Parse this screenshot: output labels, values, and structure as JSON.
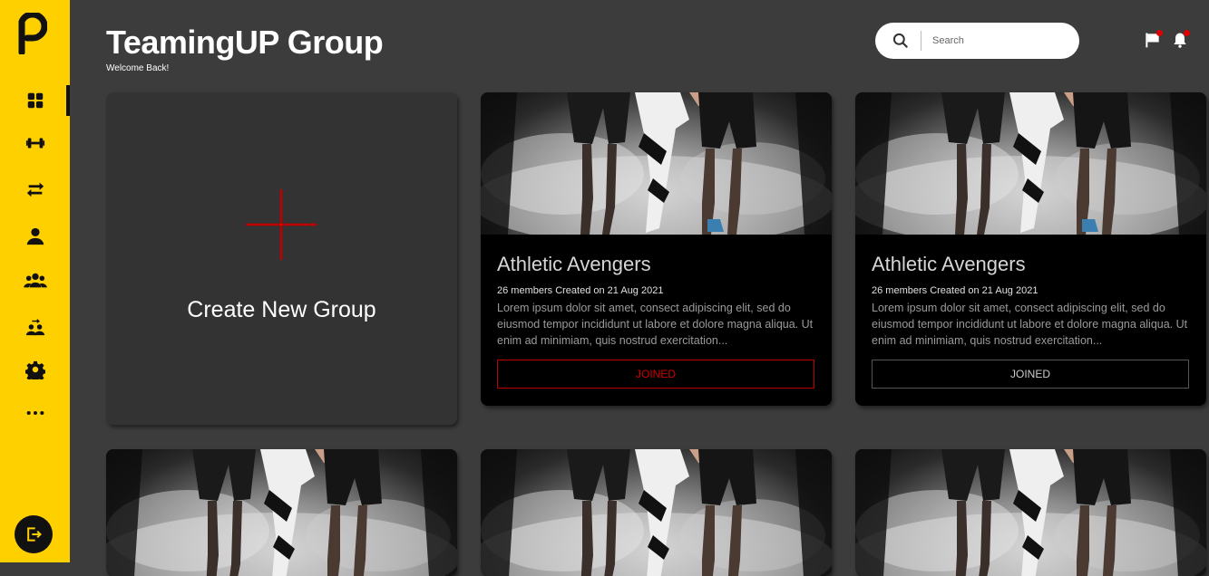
{
  "header": {
    "title": "TeamingUP Group",
    "subtitle": "Welcome Back!"
  },
  "search": {
    "placeholder": "Search"
  },
  "sidebar": {
    "items": [
      {
        "icon": "dashboard-icon"
      },
      {
        "icon": "dumbbell-icon"
      },
      {
        "icon": "transfer-arrows-icon"
      },
      {
        "icon": "user-icon"
      },
      {
        "icon": "group-icon"
      },
      {
        "icon": "team-connect-icon"
      },
      {
        "icon": "gear-icon"
      },
      {
        "icon": "more-icon"
      }
    ],
    "logout_icon": "logout-icon"
  },
  "create_card": {
    "label": "Create New Group"
  },
  "groups": [
    {
      "title": "Athletic Avengers",
      "meta": "26 members Created on 21 Aug 2021",
      "description": "Lorem ipsum dolor sit amet, consect adipiscing elit, sed do eiusmod tempor incididunt ut labore et dolore magna aliqua. Ut enim ad minimiam, quis nostrud exercitation...",
      "button": "JOINED",
      "button_style": "red"
    },
    {
      "title": "Athletic Avengers",
      "meta": "26 members Created on 21 Aug 2021",
      "description": "Lorem ipsum dolor sit amet, consect adipiscing elit, sed do eiusmod tempor incididunt ut labore et dolore magna aliqua. Ut enim ad minimiam, quis nostrud exercitation...",
      "button": "JOINED",
      "button_style": "grey"
    }
  ],
  "colors": {
    "sidebar": "#ffd000",
    "background": "#3c3c3c",
    "accent": "#d00000"
  }
}
